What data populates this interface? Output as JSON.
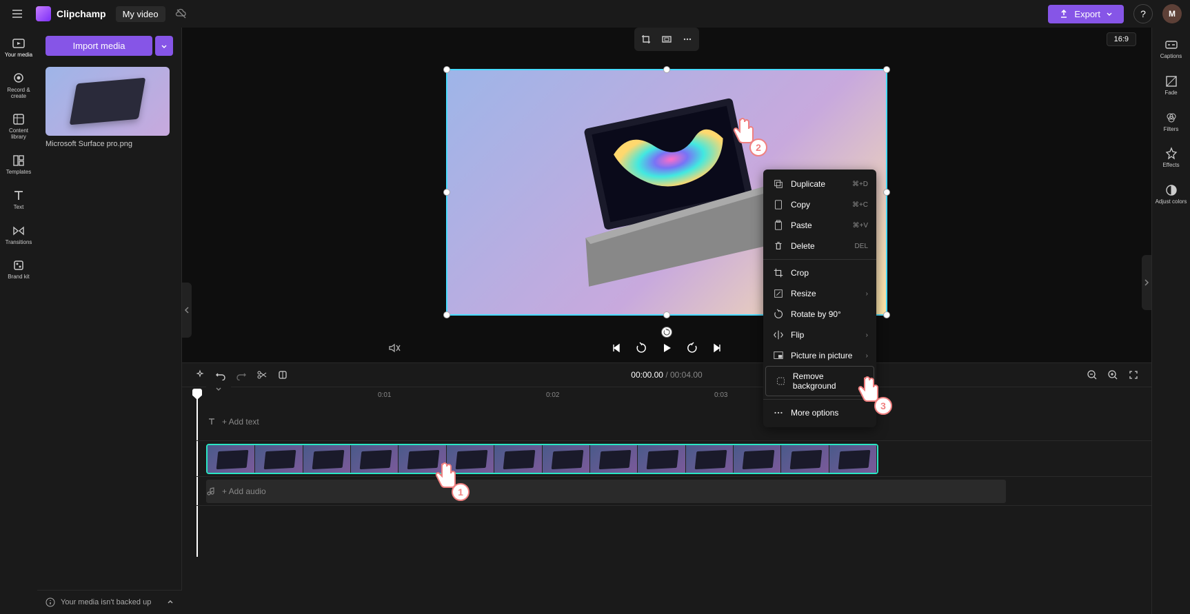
{
  "app": {
    "name": "Clipchamp",
    "project": "My video",
    "export_label": "Export",
    "aspect_ratio": "16:9",
    "avatar_letter": "M"
  },
  "rail_left": [
    {
      "id": "your-media",
      "label": "Your media",
      "active": true
    },
    {
      "id": "record",
      "label": "Record & create"
    },
    {
      "id": "content",
      "label": "Content library"
    },
    {
      "id": "templates",
      "label": "Templates"
    },
    {
      "id": "text",
      "label": "Text"
    },
    {
      "id": "transitions",
      "label": "Transitions"
    },
    {
      "id": "brand",
      "label": "Brand kit"
    }
  ],
  "rail_right": [
    {
      "id": "captions",
      "label": "Captions"
    },
    {
      "id": "fade",
      "label": "Fade"
    },
    {
      "id": "filters",
      "label": "Filters"
    },
    {
      "id": "effects",
      "label": "Effects"
    },
    {
      "id": "adjust",
      "label": "Adjust colors"
    }
  ],
  "media": {
    "import_label": "Import media",
    "items": [
      {
        "name": "Microsoft Surface pro.png"
      }
    ]
  },
  "backup_msg": "Your media isn't backed up",
  "timecode": {
    "current": "00:00.00",
    "sep": " / ",
    "duration": "00:04.00"
  },
  "ruler_ticks": [
    {
      "label": "0:01",
      "pos": 264
    },
    {
      "label": "0:02",
      "pos": 508
    },
    {
      "label": "0:03",
      "pos": 752
    }
  ],
  "tracks": {
    "text_placeholder": "+ Add text",
    "audio_placeholder": "+ Add audio"
  },
  "context_menu": [
    {
      "label": "Duplicate",
      "shortcut": "⌘+D",
      "icon": "copy-stack"
    },
    {
      "label": "Copy",
      "shortcut": "⌘+C",
      "icon": "doc"
    },
    {
      "label": "Paste",
      "shortcut": "⌘+V",
      "icon": "clipboard"
    },
    {
      "label": "Delete",
      "shortcut": "DEL",
      "icon": "trash"
    },
    {
      "divider": true
    },
    {
      "label": "Crop",
      "icon": "crop"
    },
    {
      "label": "Resize",
      "icon": "resize",
      "submenu": true
    },
    {
      "label": "Rotate by 90°",
      "icon": "rotate"
    },
    {
      "label": "Flip",
      "icon": "flip",
      "submenu": true
    },
    {
      "label": "Picture in picture",
      "icon": "pip",
      "submenu": true
    },
    {
      "label": "Remove background",
      "icon": "bg",
      "highlight": true
    },
    {
      "divider": true
    },
    {
      "label": "More options",
      "icon": "more"
    }
  ],
  "pointers": {
    "1": "1",
    "2": "2",
    "3": "3"
  }
}
